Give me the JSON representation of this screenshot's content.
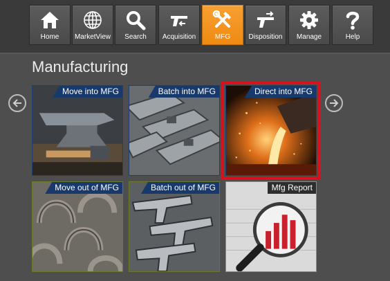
{
  "nav": {
    "items": [
      {
        "label": "Home",
        "icon": "home-icon"
      },
      {
        "label": "MarketView",
        "icon": "globe-icon"
      },
      {
        "label": "Search",
        "icon": "search-icon"
      },
      {
        "label": "Acquisition",
        "icon": "gun-in-icon"
      },
      {
        "label": "MFG",
        "icon": "tools-icon",
        "active": true
      },
      {
        "label": "Disposition",
        "icon": "gun-out-icon"
      },
      {
        "label": "Manage",
        "icon": "gear-icon"
      },
      {
        "label": "Help",
        "icon": "question-icon"
      }
    ],
    "active_color": "#ef8a12"
  },
  "page": {
    "title": "Manufacturing"
  },
  "tiles": [
    {
      "label": "Move into MFG",
      "image": "anvil-and-hammer-photo"
    },
    {
      "label": "Batch into MFG",
      "image": "rifle-receivers-photo"
    },
    {
      "label": "Direct into MFG",
      "image": "molten-metal-pour-photo",
      "selected": true
    },
    {
      "label": "Move out of MFG",
      "image": "horseshoes-photo"
    },
    {
      "label": "Batch out of MFG",
      "image": "pistols-photo"
    },
    {
      "label": "Mfg Report",
      "image": "report-with-magnifier-photo"
    }
  ],
  "colors": {
    "tile_label_bg": "#17396b",
    "selected_border": "#d7121f"
  }
}
